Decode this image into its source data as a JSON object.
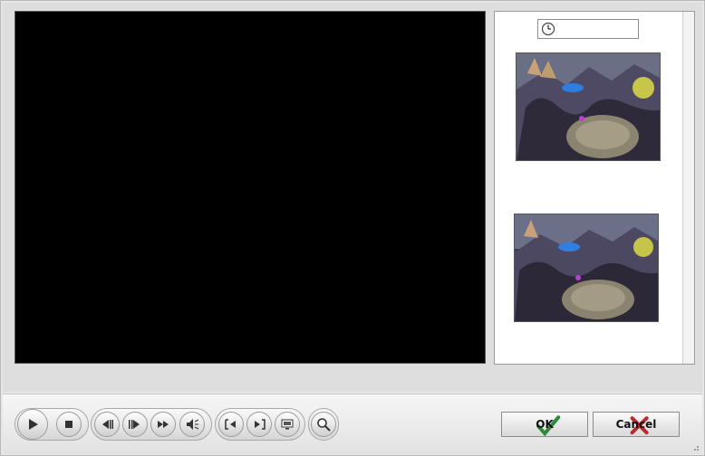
{
  "actions": {
    "ok_label": "OK",
    "cancel_label": "Cancel"
  },
  "colors": {
    "video_background": "#000000",
    "ok_check": "#2e8b3a",
    "cancel_x": "#c0262a"
  },
  "icons": {
    "time": "clock-icon",
    "play": "play-icon",
    "stop": "stop-icon",
    "step_back": "step-back-icon",
    "step_forward": "step-forward-icon",
    "fast_forward": "fast-forward-icon",
    "mute": "volume-mute-icon",
    "mark_in": "mark-in-icon",
    "mark_out": "mark-out-icon",
    "screen": "monitor-icon",
    "zoom": "magnifier-icon"
  }
}
